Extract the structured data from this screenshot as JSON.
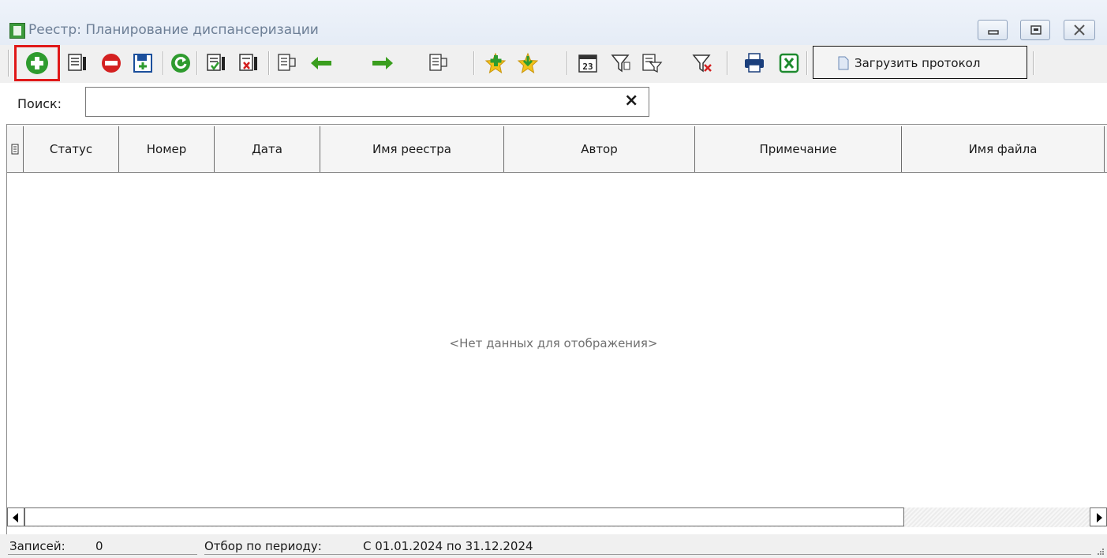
{
  "window": {
    "title": "Реестр: Планирование диспансеризации"
  },
  "toolbar": {
    "buttons": [
      {
        "name": "add",
        "icon": "plus-circle-icon",
        "highlighted": true
      },
      {
        "name": "edit",
        "icon": "document-edit-icon"
      },
      {
        "name": "delete",
        "icon": "minus-circle-icon"
      },
      {
        "name": "save",
        "icon": "floppy-disk-icon"
      },
      {
        "name": "refresh",
        "icon": "refresh-icon"
      },
      {
        "name": "approve",
        "icon": "document-check-icon"
      },
      {
        "name": "reject",
        "icon": "document-cross-icon"
      },
      {
        "name": "move-in",
        "icon": "list-arrow-icon"
      },
      {
        "name": "prev",
        "icon": "arrow-left-icon"
      },
      {
        "name": "next",
        "icon": "arrow-right-icon"
      },
      {
        "name": "move-out",
        "icon": "list-arrow-icon"
      },
      {
        "name": "favorite-add",
        "icon": "star-plus-icon"
      },
      {
        "name": "favorite",
        "icon": "star-arrow-icon"
      },
      {
        "name": "calendar",
        "icon": "calendar-icon"
      },
      {
        "name": "filter",
        "icon": "filter-icon"
      },
      {
        "name": "filter-edit",
        "icon": "filter-document-icon"
      },
      {
        "name": "filter-clear",
        "icon": "filter-clear-icon"
      },
      {
        "name": "print",
        "icon": "printer-icon"
      },
      {
        "name": "export-excel",
        "icon": "excel-icon"
      }
    ],
    "load_protocol_label": "Загрузить протокол"
  },
  "search": {
    "label": "Поиск:",
    "value": "",
    "clear_label": "×"
  },
  "grid": {
    "columns": [
      "Статус",
      "Номер",
      "Дата",
      "Имя реестра",
      "Автор",
      "Примечание",
      "Имя файла"
    ],
    "rows": [],
    "empty_text": "<Нет данных для отображения>"
  },
  "statusbar": {
    "records_label": "Записей:",
    "records_count": "0",
    "period_label": "Отбор по периоду:",
    "period_value": "С 01.01.2024 по 31.12.2024"
  },
  "colors": {
    "highlight": "#e01818",
    "add_green": "#2e9b2e",
    "delete_red": "#d42020",
    "arrow_green": "#3a9e1e",
    "star_yellow": "#f2c21a"
  }
}
